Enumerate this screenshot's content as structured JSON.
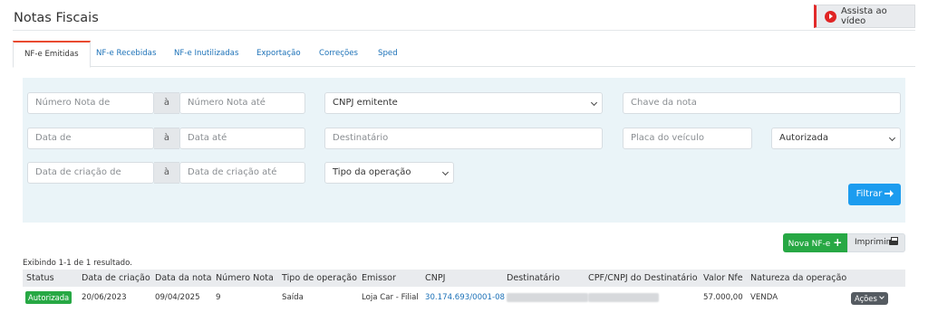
{
  "page": {
    "title": "Notas Fiscais"
  },
  "video_button": {
    "label": "Assista ao vídeo",
    "icon": "play-circle-icon",
    "accent": "#e02424"
  },
  "tabs": [
    {
      "label": "NF-e Emitidas",
      "active": true
    },
    {
      "label": "NF-e Recebidas",
      "active": false
    },
    {
      "label": "NF-e Inutilizadas",
      "active": false
    },
    {
      "label": "Exportação",
      "active": false
    },
    {
      "label": "Correções",
      "active": false
    },
    {
      "label": "Sped",
      "active": false
    }
  ],
  "filters": {
    "numero_de": {
      "placeholder": "Número Nota de"
    },
    "numero_ate": {
      "placeholder": "Número Nota até"
    },
    "separator": "à",
    "cnpj_emitente": {
      "value": "CNPJ emitente"
    },
    "chave": {
      "placeholder": "Chave da nota"
    },
    "data_de": {
      "placeholder": "Data de"
    },
    "data_ate": {
      "placeholder": "Data até"
    },
    "destinatario": {
      "placeholder": "Destinatário"
    },
    "placa": {
      "placeholder": "Placa do veículo"
    },
    "status": {
      "value": "Autorizada"
    },
    "criacao_de": {
      "placeholder": "Data de criação de"
    },
    "criacao_ate": {
      "placeholder": "Data de criação até"
    },
    "tipo_operacao": {
      "value": "Tipo da operação"
    },
    "filter_button": "Filtrar"
  },
  "actions": {
    "new_label": "Nova NF-e",
    "print_label": "Imprimir"
  },
  "table": {
    "summary": "Exibindo 1-1 de 1 resultado.",
    "columns": [
      "Status",
      "Data de criação",
      "Data da nota",
      "Número Nota",
      "Tipo de operação",
      "Emissor",
      "CNPJ",
      "Destinatário",
      "CPF/CNPJ do Destinatário",
      "Valor Nfe",
      "Natureza da operação"
    ],
    "rows": [
      {
        "status": "Autorizada",
        "data_criacao": "20/06/2023",
        "data_nota": "09/04/2025",
        "numero": "9",
        "tipo": "Saída",
        "emissor": "Loja Car - Filial",
        "cnpj": "30.174.693/0001-08",
        "valor": "57.000,00",
        "natureza": "VENDA",
        "acoes": "Ações"
      }
    ]
  },
  "colors": {
    "primary": "#1c9cef",
    "success": "#27a844",
    "tab_accent": "#e94a30",
    "panel_bg": "#eaf4f8"
  }
}
